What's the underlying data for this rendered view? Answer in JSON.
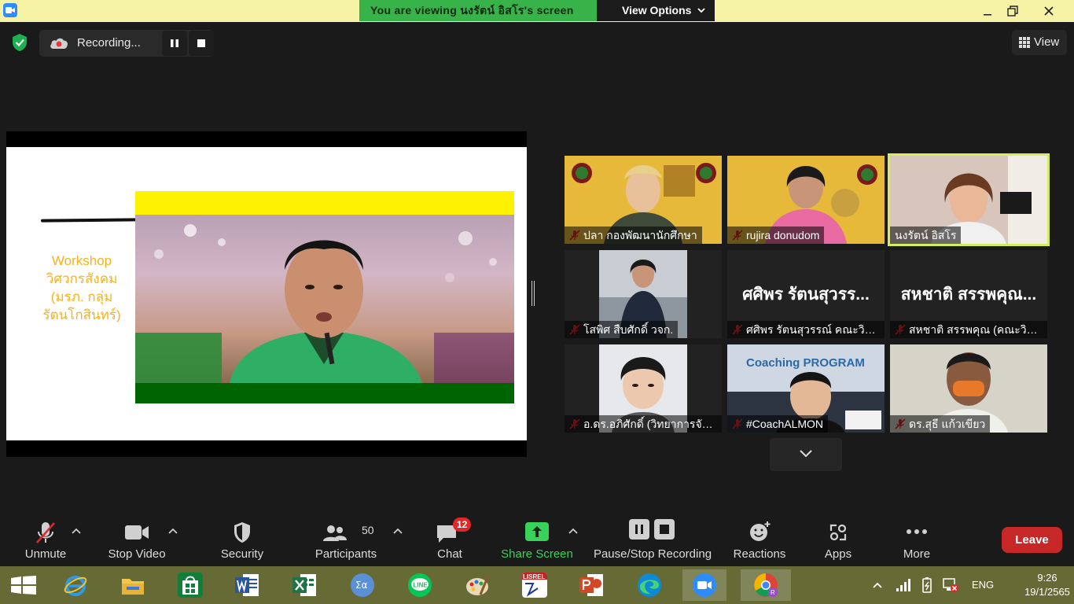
{
  "window": {
    "viewing_banner": "You are viewing นงรัตน์ อิสโร's screen",
    "view_options_label": "View Options"
  },
  "recording": {
    "status_label": "Recording..."
  },
  "view_button_label": "View",
  "slide": {
    "workshop_lines": [
      "Workshop",
      "วิศวกรสังคม",
      "(มรภ. กลุ่ม",
      "รัตนโกสินทร์)"
    ],
    "colors": {
      "text": "#f6b21c",
      "top_band": "#fff200",
      "bottom_band": "#006400"
    }
  },
  "participants": [
    {
      "name": "ปลา กองพัฒนานักศึกษา",
      "muted": true,
      "video": true
    },
    {
      "name": "rujira donudom",
      "muted": true,
      "video": true
    },
    {
      "name": "นงรัตน์ อิสโร",
      "muted": false,
      "video": true,
      "active_speaker": true
    },
    {
      "name": "โสพิศ สืบศักดิ์ วจก.",
      "muted": true,
      "video": true
    },
    {
      "name": "ศศิพร รัตนสุวรรณ์ คณะวิท...",
      "display_name": "ศศิพร รัตนสุวรร...",
      "muted": true,
      "video": false
    },
    {
      "name": "สหชาติ สรรพคุณ (คณะวิท...",
      "display_name": "สหชาติ สรรพคุณ...",
      "muted": true,
      "video": false
    },
    {
      "name": "อ.ดร.อภิศักดิ์ (วิทยาการจัด...",
      "muted": true,
      "video": true
    },
    {
      "name": "#CoachALMON",
      "muted": true,
      "video": true,
      "overlay_text": "Coaching PROGRAM"
    },
    {
      "name": "ดร.สุธี แก้วเขียว",
      "muted": true,
      "video": true
    }
  ],
  "toolbar": {
    "unmute": "Unmute",
    "stop_video": "Stop Video",
    "security": "Security",
    "participants": "Participants",
    "participants_count": "50",
    "chat": "Chat",
    "chat_badge": "12",
    "share_screen": "Share Screen",
    "pause_stop_recording": "Pause/Stop Recording",
    "reactions": "Reactions",
    "apps": "Apps",
    "more": "More",
    "leave": "Leave"
  },
  "taskbar": {
    "apps": [
      "windows-start",
      "internet-explorer",
      "file-explorer",
      "microsoft-store",
      "word",
      "excel",
      "math-input",
      "line",
      "paint",
      "lisrel",
      "powerpoint",
      "edge",
      "zoom",
      "chrome"
    ],
    "language": "ENG",
    "time": "9:26",
    "date": "19/1/2565"
  },
  "colors": {
    "banner_bg": "#f6f2a6",
    "viewing_bg": "#37b34a",
    "share_green": "#38d15a",
    "leave_red": "#c62828",
    "taskbar": "#666b36",
    "active_speaker": "#d3ee5a"
  }
}
